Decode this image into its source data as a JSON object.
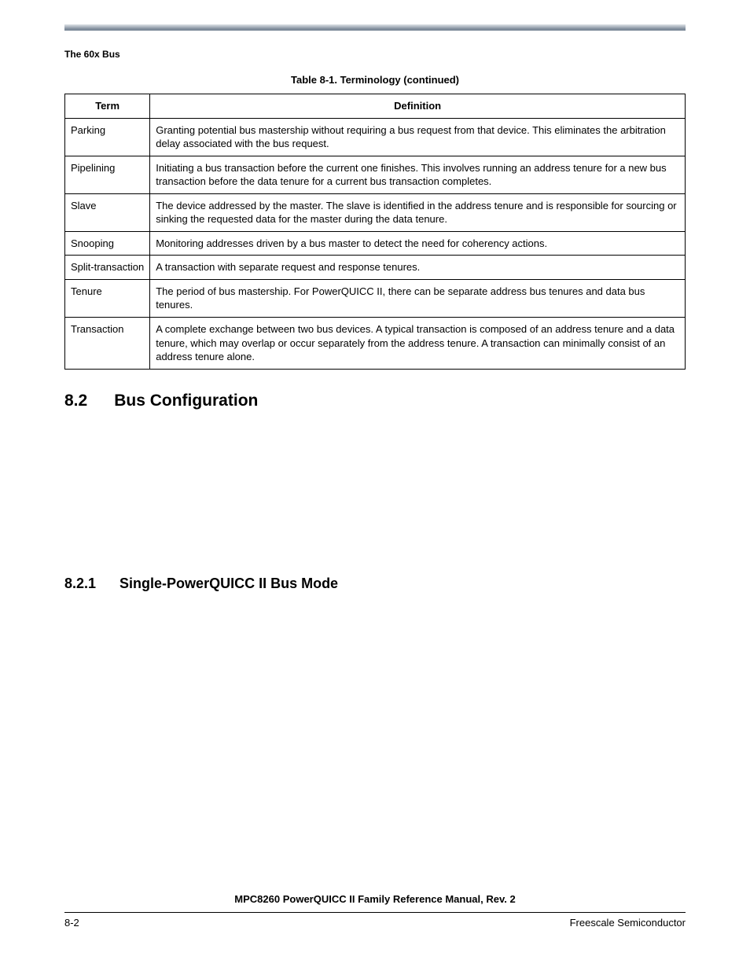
{
  "running_head": "The 60x Bus",
  "table": {
    "caption": "Table 8-1. Terminology (continued)",
    "headers": {
      "term": "Term",
      "definition": "Definition"
    },
    "rows": [
      {
        "term": "Parking",
        "definition": "Granting potential bus mastership without requiring a bus request from that device. This eliminates the arbitration delay associated with the bus request."
      },
      {
        "term": "Pipelining",
        "definition": "Initiating a bus transaction before the current one finishes. This involves running an address tenure for a new bus transaction before the data tenure for a current bus transaction completes."
      },
      {
        "term": "Slave",
        "definition": "The device addressed by the master. The slave is identified in the address tenure and is responsible for sourcing or sinking the requested data for the master during the data tenure."
      },
      {
        "term": "Snooping",
        "definition": "Monitoring addresses driven by a bus master to detect the need for coherency actions."
      },
      {
        "term": "Split-transaction",
        "definition": "A transaction with separate request and response tenures."
      },
      {
        "term": "Tenure",
        "definition": "The period of bus mastership. For PowerQUICC II, there can be separate address bus tenures and data bus tenures."
      },
      {
        "term": "Transaction",
        "definition": "A complete exchange between two bus devices. A typical transaction is composed of an address tenure and a data tenure, which may overlap or occur separately from the address tenure. A transaction can minimally consist of an address tenure alone."
      }
    ]
  },
  "headings": {
    "h2_num": "8.2",
    "h2_text": "Bus Configuration",
    "h3_num": "8.2.1",
    "h3_text": "Single-PowerQUICC II Bus Mode"
  },
  "footer": {
    "title": "MPC8260 PowerQUICC II Family Reference Manual, Rev. 2",
    "page": "8-2",
    "vendor": "Freescale Semiconductor"
  }
}
